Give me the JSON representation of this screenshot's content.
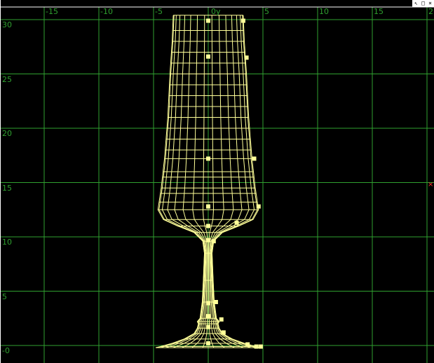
{
  "window": {
    "controls": [
      {
        "name": "restore",
        "glyph": "↖"
      },
      {
        "name": "maximize",
        "glyph": "□"
      },
      {
        "name": "close",
        "glyph": "×"
      }
    ]
  },
  "viewport": {
    "axis_tag": "0y",
    "x_ticks": [
      "-15",
      "-10",
      "-5",
      "5",
      "10",
      "15",
      "2"
    ],
    "y_ticks": [
      "30",
      "25",
      "20",
      "15",
      "10",
      "5",
      "-0"
    ],
    "grid_color": "#2fa02f",
    "wire_color": "#ffff99",
    "marker_color": "#ff3030"
  }
}
